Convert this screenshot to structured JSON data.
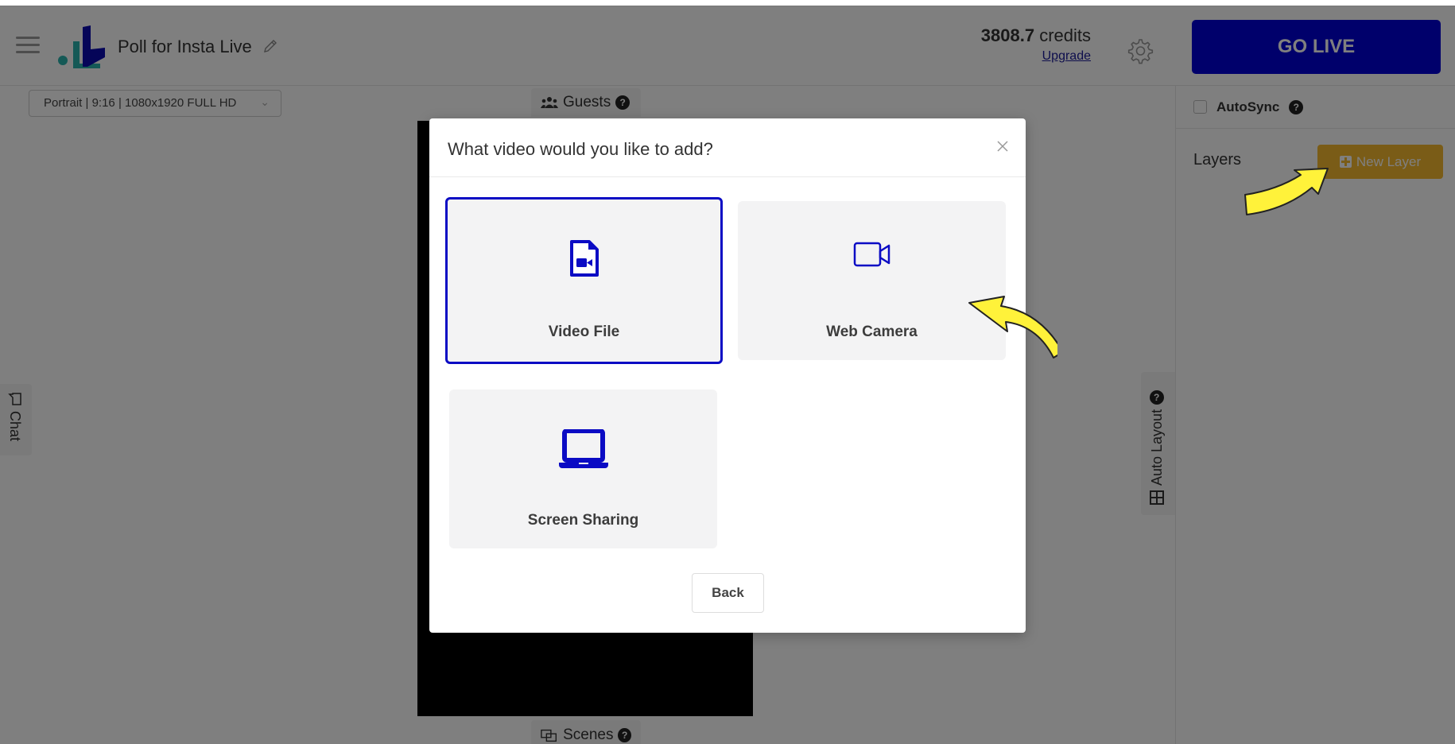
{
  "header": {
    "menu_icon": "hamburger-menu-icon",
    "logo": "brand-logo",
    "title": "Poll for Insta Live",
    "edit_icon": "pencil-icon",
    "credits_amount": "3808.7",
    "credits_label": "credits",
    "upgrade_label": "Upgrade",
    "settings_icon": "gear-icon",
    "go_live_label": "GO LIVE"
  },
  "stage": {
    "format_select_value": "Portrait | 9:16 | 1080x1920 FULL HD",
    "guests_tab_label": "Guests",
    "scenes_tab_label": "Scenes",
    "chat_tab_label": "Chat",
    "auto_layout_tab_label": "Auto Layout",
    "help_glyph": "?"
  },
  "right_panel": {
    "autosync_label": "AutoSync",
    "autosync_checked": false,
    "layers_title": "Layers",
    "new_layer_label": "New Layer"
  },
  "modal": {
    "title": "What video would you like to add?",
    "close_icon": "close-icon",
    "options": [
      {
        "label": "Video File",
        "icon": "file-video-icon",
        "selected": true
      },
      {
        "label": "Web Camera",
        "icon": "video-camera-icon",
        "selected": false
      },
      {
        "label": "Screen Sharing",
        "icon": "laptop-icon",
        "selected": false
      }
    ],
    "back_label": "Back"
  },
  "colors": {
    "brand_blue": "#0000d6",
    "option_icon_blue": "#0b0bc4",
    "new_layer_yellow": "#f5b82e",
    "logo_teal": "#2bb3ad",
    "annotation_arrow": "#fff23a"
  }
}
